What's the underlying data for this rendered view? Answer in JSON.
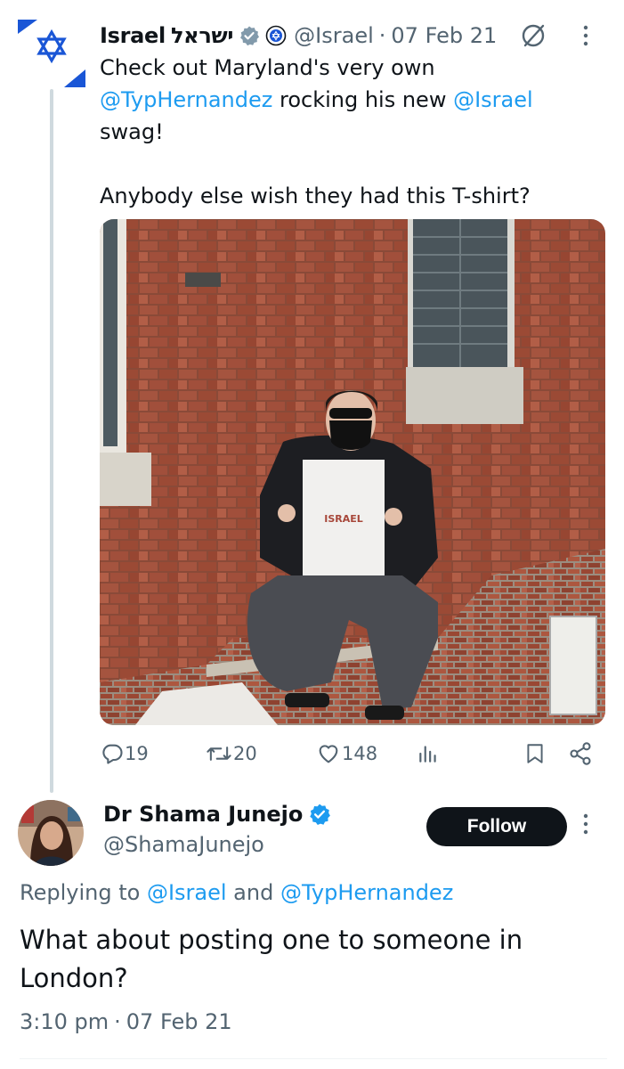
{
  "tweet": {
    "author_name": "Israel",
    "author_name_hebrew": "ישראל",
    "handle": "@Israel",
    "separator": "·",
    "date": "07 Feb 21",
    "text_parts": {
      "line1": "Check out Maryland's very own",
      "mention1": "@TypHernandez",
      "mid": " rocking his new ",
      "mention2": "@Israel",
      "end": "swag!",
      "line2": "Anybody else wish they had this T-shirt?"
    },
    "image_shirt_text": "ISRAEL",
    "icons": {
      "verified": "verified-badge-icon",
      "affiliate": "government-seal-icon",
      "grok": "grok-icon",
      "more": "more-vertical-icon"
    },
    "stats": {
      "replies": "19",
      "retweets": "20",
      "likes": "148"
    }
  },
  "reply": {
    "author_name": "Dr Shama Junejo",
    "handle": "@ShamaJunejo",
    "follow_label": "Follow",
    "replying_prefix": "Replying to ",
    "replying_mention1": "@Israel",
    "replying_and": " and ",
    "replying_mention2": "@TypHernandez",
    "text": "What about posting one to someone in London?",
    "time": "3:10 pm",
    "separator": "·",
    "date": "07 Feb 21"
  },
  "colors": {
    "link": "#1d9bf0",
    "muted": "#536471",
    "verified": "#1d9bf0",
    "israel_blue": "#1a56d6",
    "follow_bg": "#0f1419"
  }
}
